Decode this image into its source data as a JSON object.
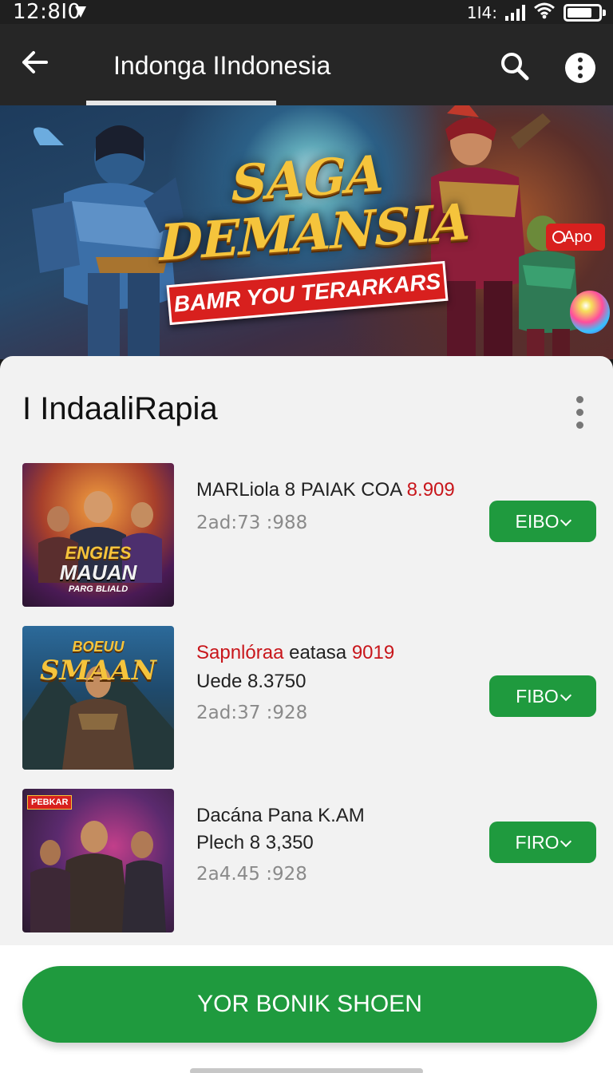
{
  "status_bar": {
    "time": "12:8I0",
    "network": "1I4:"
  },
  "app_bar": {
    "title": "Indonga IIndonesia"
  },
  "banner": {
    "badge": "Apo",
    "title_line1": "SAGA",
    "title_line2": "DEMANSIA",
    "ribbon": "BAMR YOU TERARKARS"
  },
  "section": {
    "title": "I IndaaliRapia"
  },
  "games": [
    {
      "thumb_title": "ENGIES",
      "thumb_title2": "MAUAN",
      "thumb_sub": "PARG BLIALD",
      "line1": "MARLiola 8 PAIAK COA ",
      "line1_price": "8.909",
      "line2": "",
      "line3": "2ad:73 :988",
      "button": "EIBO"
    },
    {
      "thumb_title": "BOEUU",
      "thumb_title2": "SMAAN",
      "thumb_sub": "",
      "line1_red": "Sapnlóraa",
      "line1": " eatasa ",
      "line1_price": "9019",
      "line2": "Uede 8.3750",
      "line3": "2ad:37 :928",
      "button": "FIBO"
    },
    {
      "thumb_title": "PEBKAR",
      "thumb_title2": "",
      "thumb_sub": "",
      "line1": "Dacána Pana K.AM",
      "line2": "Plech 8 3,350",
      "line3": "2a4.45 :928",
      "button": "FIRO"
    }
  ],
  "cta": {
    "label": "YOR BONIK SHOEN"
  },
  "colors": {
    "accent_green": "#1f9a3e",
    "price_red": "#c8161b",
    "app_bar": "#262626"
  }
}
